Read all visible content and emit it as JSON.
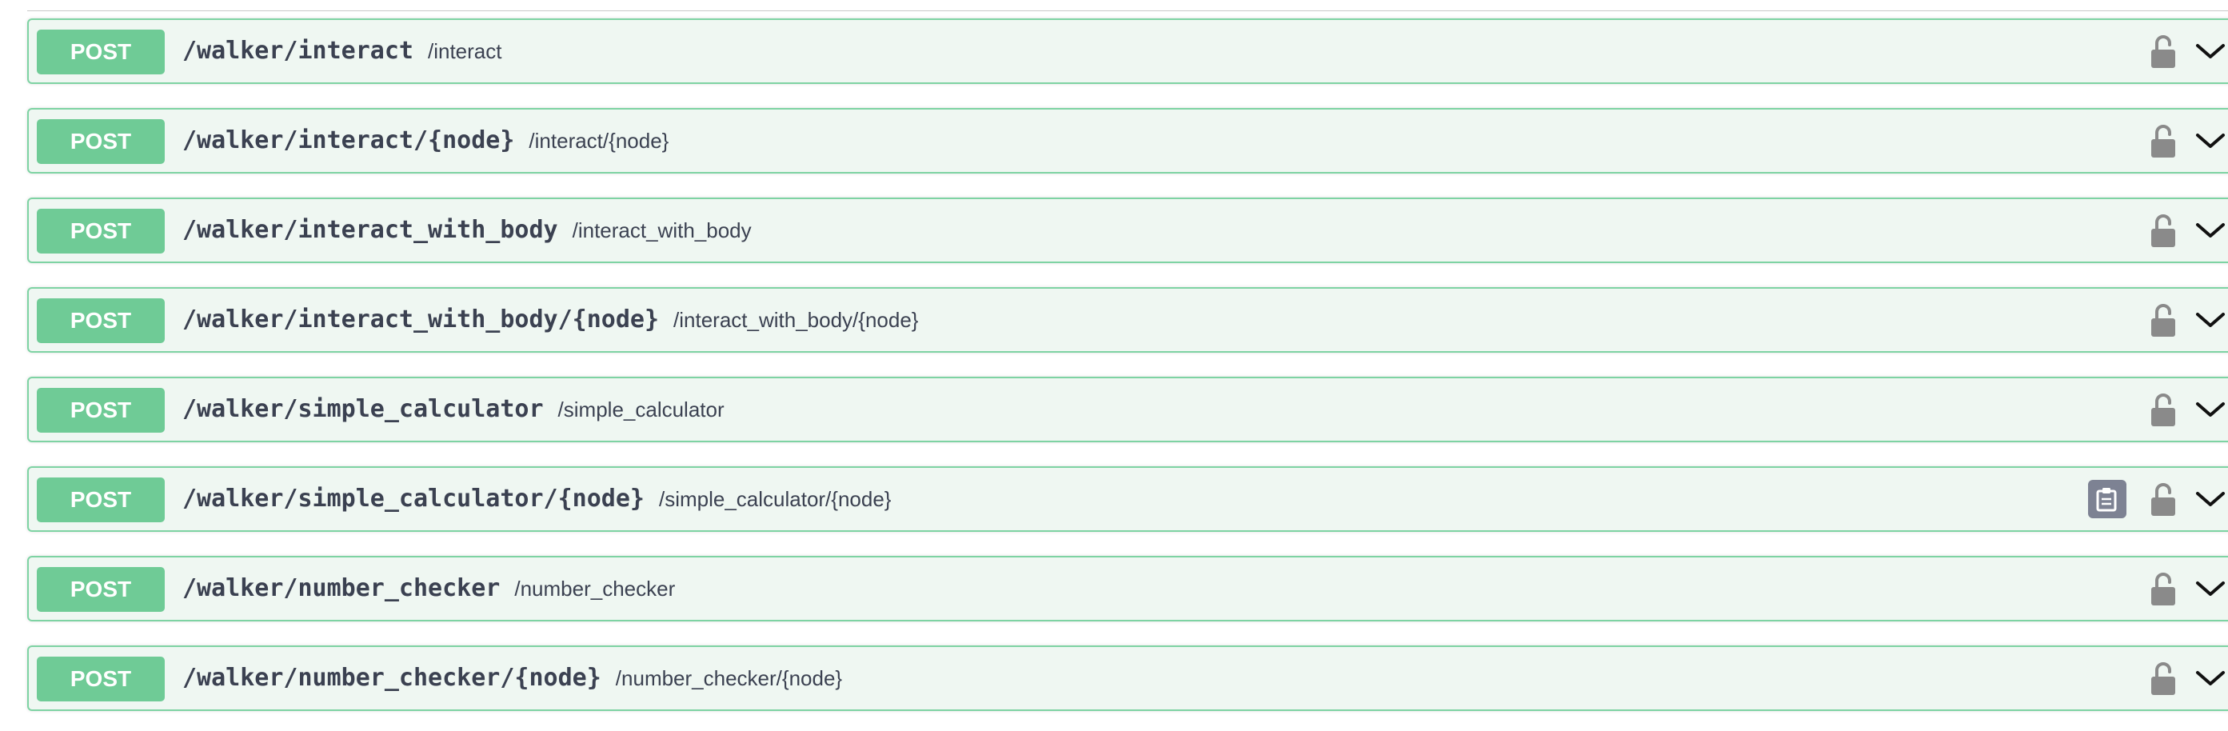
{
  "operations": [
    {
      "method": "POST",
      "path": "/walker/interact",
      "summary": "/interact",
      "copy_visible": false
    },
    {
      "method": "POST",
      "path": "/walker/interact/{node}",
      "summary": "/interact/{node}",
      "copy_visible": false
    },
    {
      "method": "POST",
      "path": "/walker/interact_with_body",
      "summary": "/interact_with_body",
      "copy_visible": false
    },
    {
      "method": "POST",
      "path": "/walker/interact_with_body/{node}",
      "summary": "/interact_with_body/{node}",
      "copy_visible": false
    },
    {
      "method": "POST",
      "path": "/walker/simple_calculator",
      "summary": "/simple_calculator",
      "copy_visible": false
    },
    {
      "method": "POST",
      "path": "/walker/simple_calculator/{node}",
      "summary": "/simple_calculator/{node}",
      "copy_visible": true
    },
    {
      "method": "POST",
      "path": "/walker/number_checker",
      "summary": "/number_checker",
      "copy_visible": false
    },
    {
      "method": "POST",
      "path": "/walker/number_checker/{node}",
      "summary": "/number_checker/{node}",
      "copy_visible": false
    }
  ],
  "icons": {
    "lock": "lock-icon",
    "chevron": "chevron-down-icon",
    "copy": "clipboard-copy-icon"
  },
  "colors": {
    "method_post": "#6fcb96",
    "border": "#7ed3a3",
    "row_background": "#eff7f2",
    "text": "#3b4151",
    "icon_gray": "#8a8a8a",
    "copy_button": "#7d8293"
  }
}
